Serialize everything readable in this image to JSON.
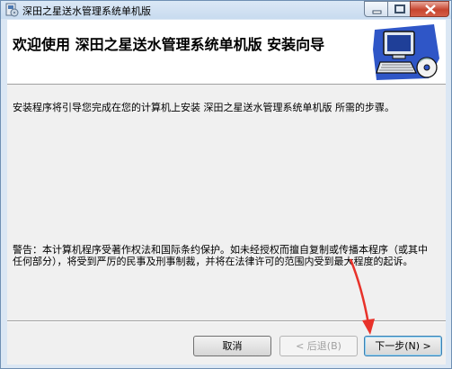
{
  "window": {
    "title": "深田之星送水管理系统单机版",
    "controls": {
      "minimize": "minimize",
      "maximize": "maximize",
      "close": "close"
    }
  },
  "header": {
    "title": "欢迎使用  深田之星送水管理系统单机版  安装向导",
    "art_icon": "computer-with-cd-icon"
  },
  "body": {
    "intro": "安装程序将引导您完成在您的计算机上安装 深田之星送水管理系统单机版 所需的步骤。",
    "warning": "警告：本计算机程序受著作权法和国际条约保护。如未经授权而擅自复制或传播本程序（或其中任何部分），将受到严厉的民事及刑事制裁，并将在法律许可的范围内受到最大程度的起诉。"
  },
  "buttons": {
    "cancel": "取消",
    "back": "< 后退(B)",
    "next": "下一步(N) >"
  },
  "annotation": {
    "color": "#e8322a",
    "target": "next-button"
  }
}
